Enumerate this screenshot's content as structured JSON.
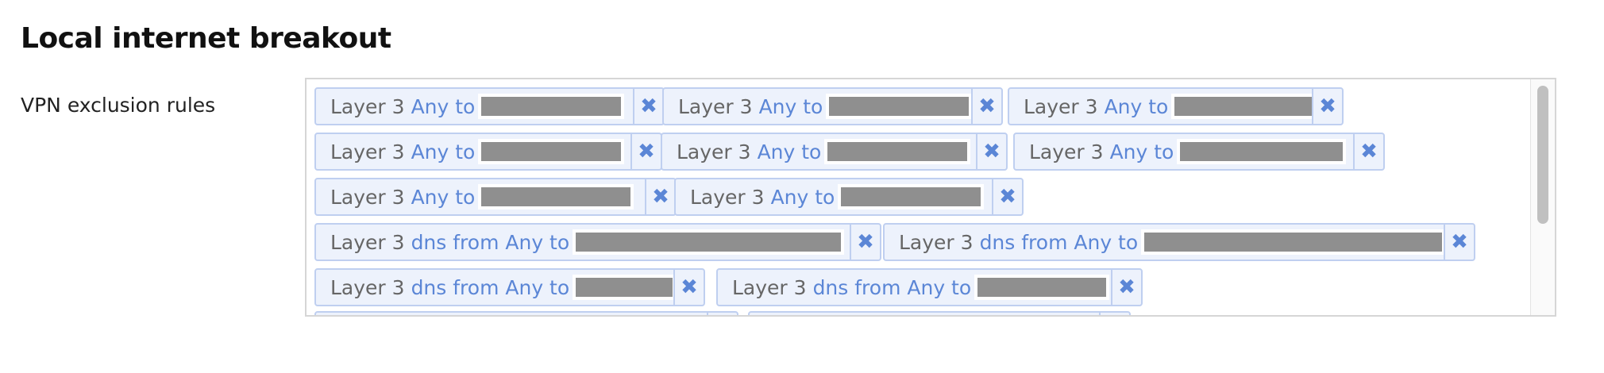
{
  "section": {
    "title": "Local internet breakout"
  },
  "field": {
    "label": "VPN exclusion rules"
  },
  "rules": [
    {
      "layer": "Layer 3",
      "description": "Any to",
      "remove_symbol": "✖"
    },
    {
      "layer": "Layer 3",
      "description": "Any to",
      "remove_symbol": "✖"
    },
    {
      "layer": "Layer 3",
      "description": "Any to",
      "remove_symbol": "✖"
    },
    {
      "layer": "Layer 3",
      "description": "Any to",
      "remove_symbol": "✖"
    },
    {
      "layer": "Layer 3",
      "description": "Any to",
      "remove_symbol": "✖"
    },
    {
      "layer": "Layer 3",
      "description": "Any to",
      "remove_symbol": "✖"
    },
    {
      "layer": "Layer 3",
      "description": "Any to",
      "remove_symbol": "✖"
    },
    {
      "layer": "Layer 3",
      "description": "Any to",
      "remove_symbol": "✖"
    },
    {
      "layer": "Layer 3",
      "description": "dns from Any to",
      "remove_symbol": "✖"
    },
    {
      "layer": "Layer 3",
      "description": "dns from Any to",
      "remove_symbol": "✖"
    },
    {
      "layer": "Layer 3",
      "description": "dns from Any to",
      "remove_symbol": "✖"
    },
    {
      "layer": "Layer 3",
      "description": "dns from Any to",
      "remove_symbol": "✖"
    }
  ]
}
